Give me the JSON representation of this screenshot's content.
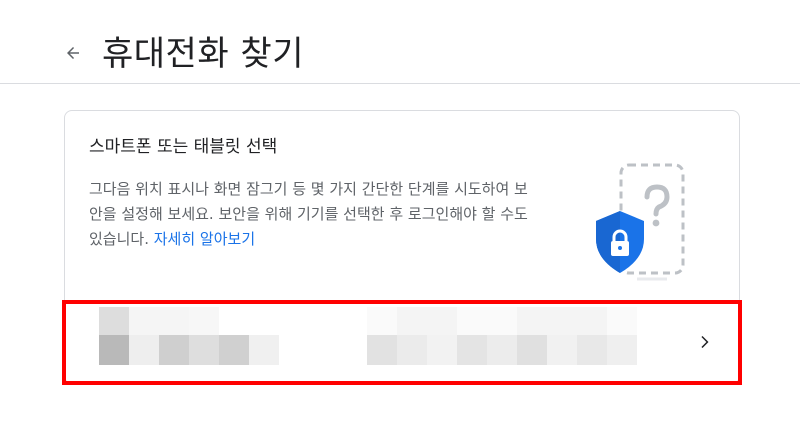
{
  "header": {
    "back_icon": "arrow-back-icon",
    "title": "휴대전화 찾기"
  },
  "card": {
    "title": "스마트폰 또는 태블릿 선택",
    "description": "그다음 위치 표시나 화면 잠그기 등 몇 가지 간단한 단계를 시도하여 보안을 설정해 보세요. 보안을 위해 기기를 선택한 후 로그인해야 할 수도 있습니다.",
    "learn_more": "자세히 알아보기",
    "illustration_icon": "phone-question-shield-lock-icon"
  },
  "device_row": {
    "chevron_icon": "chevron-right-icon"
  },
  "colors": {
    "link": "#1a73e8",
    "shield": "#1a73e8",
    "highlight": "#ff0000",
    "border": "#dadce0"
  }
}
